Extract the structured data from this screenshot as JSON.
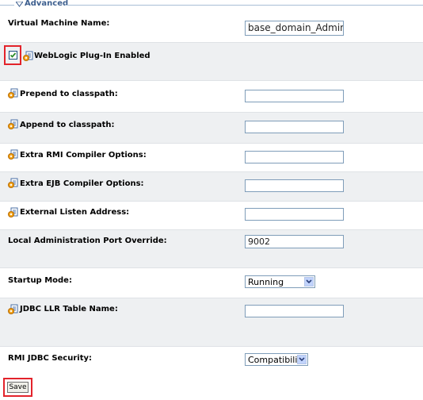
{
  "section": {
    "title": "Advanced"
  },
  "rows": [
    {
      "label": "Virtual Machine Name:",
      "value": "base_domain_AdminServe"
    },
    {
      "label": "WebLogic Plug-In Enabled",
      "checked": true
    },
    {
      "label": "Prepend to classpath:",
      "value": ""
    },
    {
      "label": "Append to classpath:",
      "value": ""
    },
    {
      "label": "Extra RMI Compiler Options:",
      "value": ""
    },
    {
      "label": "Extra EJB Compiler Options:",
      "value": ""
    },
    {
      "label": "External Listen Address:",
      "value": ""
    },
    {
      "label": "Local Administration Port Override:",
      "value": "9002"
    },
    {
      "label": "Startup Mode:",
      "selected": "Running"
    },
    {
      "label": "JDBC LLR Table Name:",
      "value": ""
    },
    {
      "label": "RMI JDBC Security:",
      "selected": "Compatibility"
    }
  ],
  "buttons": {
    "save": "Save"
  },
  "colors": {
    "highlight": "#e3232b",
    "header_text": "#3d5f8f",
    "row_shade": "#eef0f2",
    "input_border": "#7f9db9"
  }
}
